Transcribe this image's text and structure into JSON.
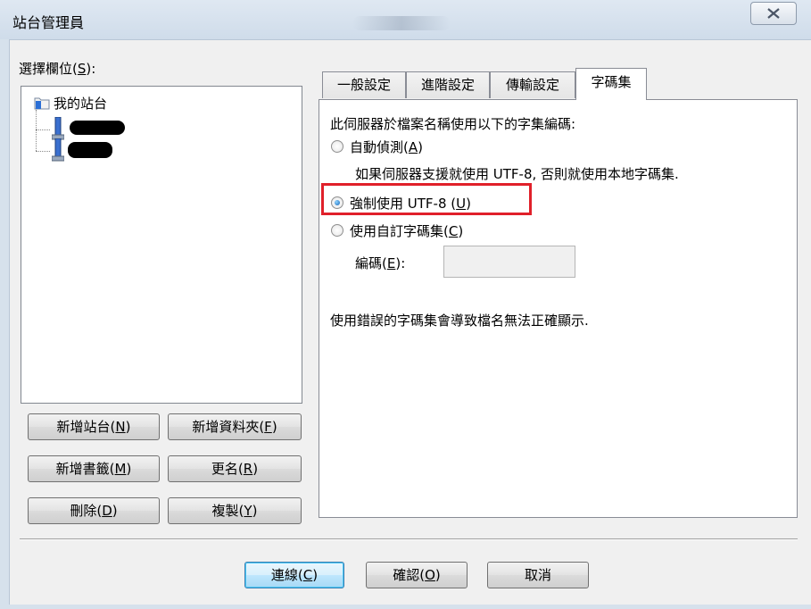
{
  "window": {
    "title": "站台管理員",
    "close_glyph": "✕"
  },
  "left": {
    "select_label_pre": "選擇欄位(",
    "select_label_key": "S",
    "select_label_post": "):",
    "tree": {
      "root_label": "我的站台"
    },
    "buttons": {
      "new_site": {
        "pre": "新增站台(",
        "key": "N",
        "post": ")"
      },
      "new_folder": {
        "pre": "新增資料夾(",
        "key": "F",
        "post": ")"
      },
      "new_bookmark": {
        "pre": "新增書籤(",
        "key": "M",
        "post": ")"
      },
      "rename": {
        "pre": "更名(",
        "key": "R",
        "post": ")"
      },
      "delete": {
        "pre": "刪除(",
        "key": "D",
        "post": ")"
      },
      "copy": {
        "pre": "複製(",
        "key": "Y",
        "post": ")"
      }
    }
  },
  "tabs": [
    {
      "label": "一般設定"
    },
    {
      "label": "進階設定"
    },
    {
      "label": "傳輸設定"
    },
    {
      "label": "字碼集"
    }
  ],
  "active_tab": "字碼集",
  "charset": {
    "heading": "此伺服器於檔案名稱使用以下的字集編碼:",
    "opt_auto": {
      "pre": "自動偵測(",
      "key": "A",
      "post": ")"
    },
    "opt_auto_desc": "如果伺服器支援就使用 UTF-8, 否則就使用本地字碼集.",
    "opt_utf8": {
      "pre": "強制使用 UTF-8 (",
      "key": "U",
      "post": ")"
    },
    "opt_custom": {
      "pre": "使用自訂字碼集(",
      "key": "C",
      "post": ")"
    },
    "encoding_label": {
      "pre": "編碼(",
      "key": "E",
      "post": "):"
    },
    "encoding_value": "",
    "warning": "使用錯誤的字碼集會導致檔名無法正確顯示.",
    "selected": "utf8"
  },
  "footer": {
    "connect": {
      "pre": "連線(",
      "key": "C",
      "post": ")"
    },
    "ok": {
      "pre": "確認(",
      "key": "O",
      "post": ")"
    },
    "cancel": "取消"
  },
  "colors": {
    "highlight_box": "#e0202a",
    "titlebar": "#d6e1ec"
  }
}
